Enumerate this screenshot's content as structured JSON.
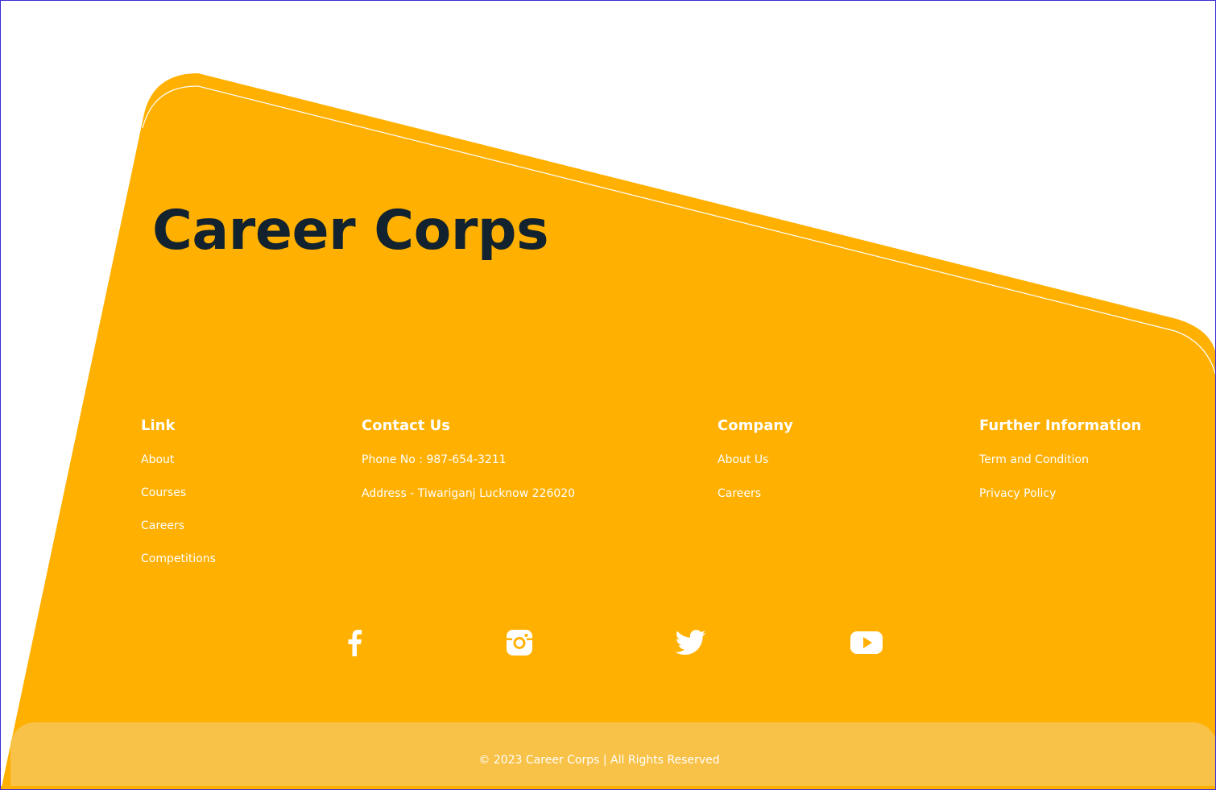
{
  "brand": {
    "name": "Career Corps"
  },
  "footer": {
    "columns": {
      "link": {
        "heading": "Link",
        "items": [
          "About",
          "Courses",
          "Careers",
          "Competitions"
        ]
      },
      "contact": {
        "heading": "Contact Us",
        "items": [
          "Phone No :  987-654-3211",
          "Address - Tiwariganj Lucknow 226020"
        ]
      },
      "company": {
        "heading": "Company",
        "items": [
          "About Us",
          "Careers"
        ]
      },
      "further": {
        "heading": "Further Information",
        "items": [
          "Term and Condition",
          "Privacy Policy"
        ]
      }
    },
    "social": [
      {
        "icon": "facebook-icon"
      },
      {
        "icon": "instagram-icon"
      },
      {
        "icon": "twitter-icon"
      },
      {
        "icon": "youtube-icon"
      }
    ],
    "copyright": "© 2023 Career Corps | All Rights Reserved"
  },
  "colors": {
    "primary": "#ffb000",
    "copyright_bar": "#f8c147",
    "title": "#12222e",
    "text": "#ffffff",
    "frame_border": "#3b2bd6"
  }
}
